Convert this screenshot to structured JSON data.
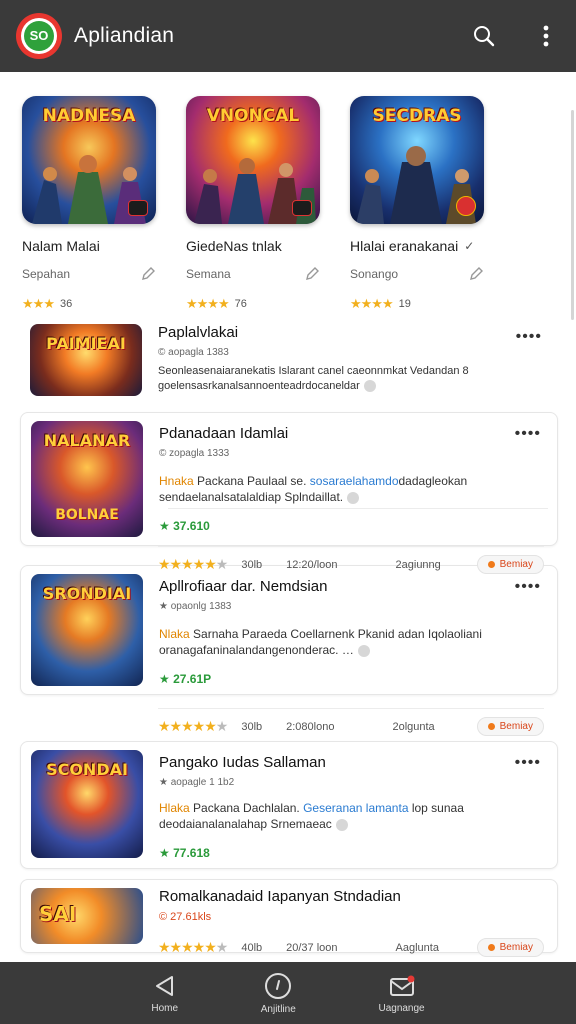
{
  "app": {
    "logo_text": "SO",
    "title": "Apliandian"
  },
  "featured": [
    {
      "art_title": "NADNESA",
      "name": "Nalam Malai",
      "sub": "Sepahan",
      "rating_text": "36",
      "stars": 3,
      "name_suffix": ""
    },
    {
      "art_title": "VNONCAL",
      "name": "GiedeNas tnlak",
      "sub": "Semana",
      "rating_text": "76",
      "stars": 4,
      "name_suffix": ""
    },
    {
      "art_title": "SECDRAS",
      "name": "Hlalai eranakanai",
      "sub": "Sonango",
      "rating_text": "19",
      "stars": 4,
      "name_suffix": "✓"
    }
  ],
  "list": [
    {
      "thumb_title": "PAIMIEAI",
      "thumb_title2": "",
      "title": "Paplalvlakai",
      "meta": "© aopagla 1383",
      "desc_hl1": "",
      "desc_hl2": "",
      "desc": "Seonleasenaiaranekatis Islarant canel caeonnmkat Vedandan 8 goelensasrkanalsannoenteadrdocaneldar",
      "has_footer": false,
      "card": false
    },
    {
      "thumb_title": "NALANAR",
      "thumb_title2": "BOLNAE",
      "title": "Pdanadaan Idamlai",
      "meta": "© zopagla 1333",
      "desc_hl1": "Hnaka",
      "desc_mid": " Packana Paulaal se. ",
      "desc_hl2": "sosaraelahamdo",
      "desc": "dadagleokan sendaelanalsatalaldiap Splndaillat.",
      "price": "★ 37.610",
      "footer": {
        "stars": 5,
        "c1": "30lb",
        "c2": "12:20/loon",
        "c3": "2agiunng",
        "pill": "Bemiay"
      },
      "has_footer": true,
      "card": true
    },
    {
      "thumb_title": "SRONDIAI",
      "thumb_title2": "",
      "title": "Apllrofiaar dar. Nemdsian",
      "meta": "★ opaonlg 1383",
      "desc_hl1": "Nlaka",
      "desc_mid": " Sarnaha Paraeda Coellarnenk Pkanid adan Iqolaoliani ",
      "desc_hl2": "",
      "desc": "oranagafaninalandangenonderac. …",
      "price": "★ 27.61P",
      "footer": {
        "stars": 5,
        "c1": "30lb",
        "c2": "2:080lono",
        "c3": "2olgunta",
        "pill": "Bemiay"
      },
      "has_footer": true,
      "card": true
    },
    {
      "thumb_title": "SCONDAI",
      "thumb_title2": "",
      "title": "Pangako Iudas Sallaman",
      "meta": "★ aopagle 1 1b2",
      "desc_hl1": "Hlaka",
      "desc_mid": " Packana Dachlalan. ",
      "desc_hl2": "Geseranan lamanta",
      "desc": " lop sunaa deodaianalanalahap Srnemaeac",
      "price": "★ 77.618",
      "has_footer": false,
      "card": true
    },
    {
      "thumb_title": "SAI",
      "thumb_title2": "",
      "title": "Romalkanadaid Iapanyan Stndadian",
      "meta": "© 27.61kls",
      "footer": {
        "stars": 5,
        "c1": "40lb",
        "c2": "20/37 loon",
        "c3": "Aaglunta",
        "pill": "Bemiay"
      },
      "has_footer": true,
      "card": true
    }
  ],
  "nav": [
    {
      "label": "Home",
      "icon": "back-triangle-icon"
    },
    {
      "label": "Anjitline",
      "icon": "circle-icon"
    },
    {
      "label": "Uagnange",
      "icon": "mail-icon"
    }
  ],
  "colors": {
    "appbar": "#3a3a3a",
    "accent_green": "#2fa13b",
    "logo_red": "#e8362f",
    "star": "#f2b01e"
  }
}
